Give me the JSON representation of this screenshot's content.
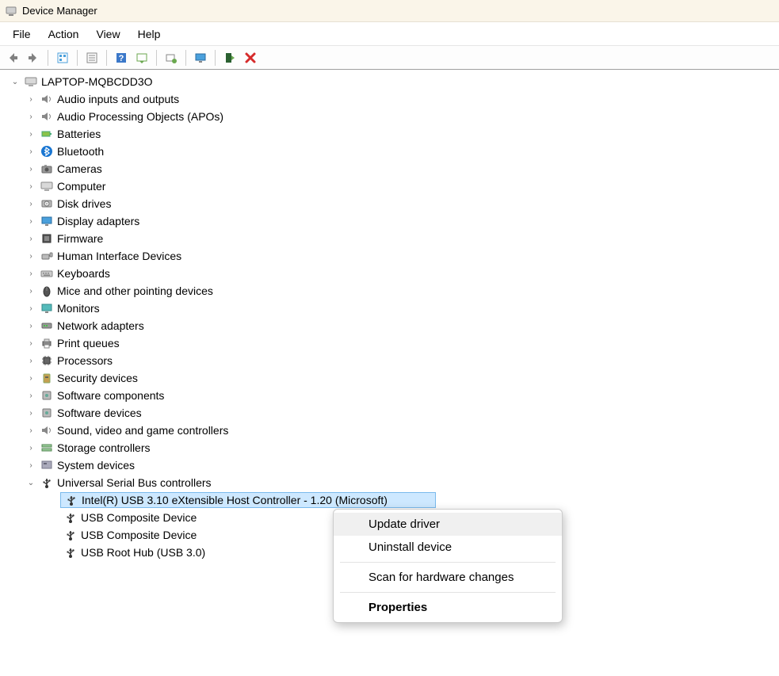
{
  "window": {
    "title": "Device Manager"
  },
  "menubar": {
    "file": "File",
    "action": "Action",
    "view": "View",
    "help": "Help"
  },
  "tree": {
    "root": "LAPTOP-MQBCDD3O",
    "categories": [
      "Audio inputs and outputs",
      "Audio Processing Objects (APOs)",
      "Batteries",
      "Bluetooth",
      "Cameras",
      "Computer",
      "Disk drives",
      "Display adapters",
      "Firmware",
      "Human Interface Devices",
      "Keyboards",
      "Mice and other pointing devices",
      "Monitors",
      "Network adapters",
      "Print queues",
      "Processors",
      "Security devices",
      "Software components",
      "Software devices",
      "Sound, video and game controllers",
      "Storage controllers",
      "System devices",
      "Universal Serial Bus controllers"
    ],
    "usbChildren": [
      "Intel(R) USB 3.10 eXtensible Host Controller - 1.20 (Microsoft)",
      "USB Composite Device",
      "USB Composite Device",
      "USB Root Hub (USB 3.0)"
    ]
  },
  "contextMenu": {
    "updateDriver": "Update driver",
    "uninstall": "Uninstall device",
    "scan": "Scan for hardware changes",
    "properties": "Properties"
  }
}
